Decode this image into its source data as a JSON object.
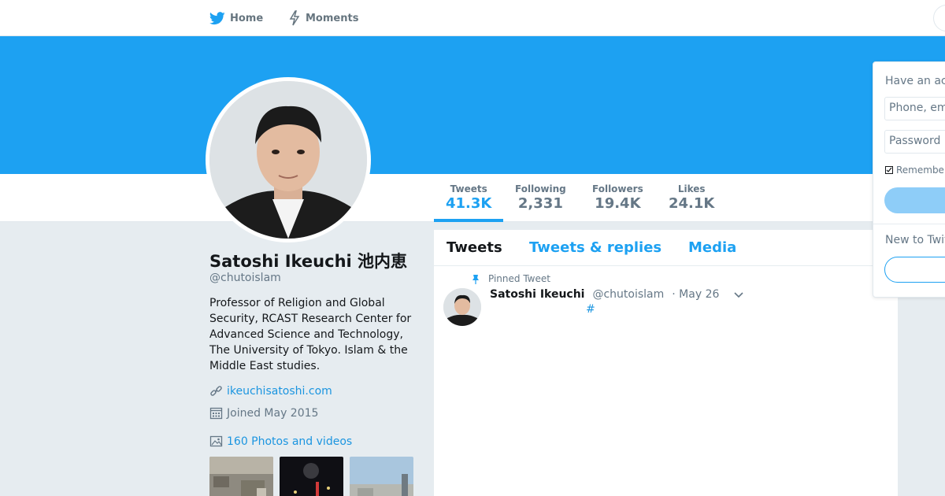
{
  "nav": {
    "home_label": "Home",
    "moments_label": "Moments"
  },
  "colors": {
    "brand": "#1da1f2",
    "link": "#1b95e0",
    "muted": "#657786"
  },
  "profile_stats": [
    {
      "label": "Tweets",
      "value": "41.3K",
      "active": true
    },
    {
      "label": "Following",
      "value": "2,331",
      "active": false
    },
    {
      "label": "Followers",
      "value": "19.4K",
      "active": false
    },
    {
      "label": "Likes",
      "value": "24.1K",
      "active": false
    }
  ],
  "profile": {
    "name": "Satoshi Ikeuchi 池内恵",
    "handle": "@chutoislam",
    "bio": "Professor of Religion and Global Security, RCAST Research Center for Advanced Science and Technology, The University of Tokyo. Islam & the Middle East studies.",
    "website": "ikeuchisatoshi.com",
    "joined": "Joined May 2015",
    "media_label": "160 Photos and videos"
  },
  "timeline": {
    "tabs": [
      "Tweets",
      "Tweets & replies",
      "Media"
    ],
    "pinned_label": "Pinned Tweet",
    "tweet": {
      "name": "Satoshi Ikeuchi",
      "handle": "@chutoislam",
      "date": "· May 26",
      "hashtag": "#"
    }
  },
  "login": {
    "title": "Have an account?",
    "phone_placeholder": "Phone, email, or username",
    "password_placeholder": "Password",
    "remember_label": "Remember me",
    "new_to_label": "New to Twitter?"
  }
}
